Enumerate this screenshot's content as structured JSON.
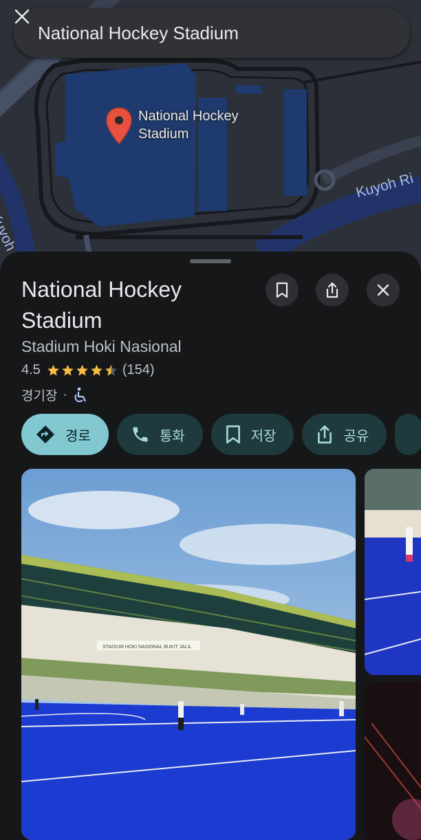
{
  "search": {
    "query": "National Hockey Stadium"
  },
  "map": {
    "pin_label": "National Hockey Stadium",
    "road_labels": [
      "Kuyoh Ri",
      "Kuyoh"
    ]
  },
  "place": {
    "title": "National Hockey Stadium",
    "subtitle": "Stadium Hoki Nasional",
    "rating": "4.5",
    "stars": 4.5,
    "review_count": "(154)",
    "category": "경기장",
    "separator": "·"
  },
  "actions": [
    {
      "label": "경로",
      "icon": "directions-icon"
    },
    {
      "label": "통화",
      "icon": "phone-icon"
    },
    {
      "label": "저장",
      "icon": "bookmark-icon"
    },
    {
      "label": "공유",
      "icon": "share-icon"
    }
  ],
  "photo": {
    "banner_text": "STADIUM HOKI NASIONAL BUKIT JALIL"
  },
  "colors": {
    "accent": "#82c8d0",
    "chip_bg": "#1f3a3d",
    "star": "#f6bb42",
    "pin": "#e8513f",
    "sheet_bg": "#161719",
    "map_bg": "#2c3038",
    "pitch_blue": "#1c3bd0"
  }
}
